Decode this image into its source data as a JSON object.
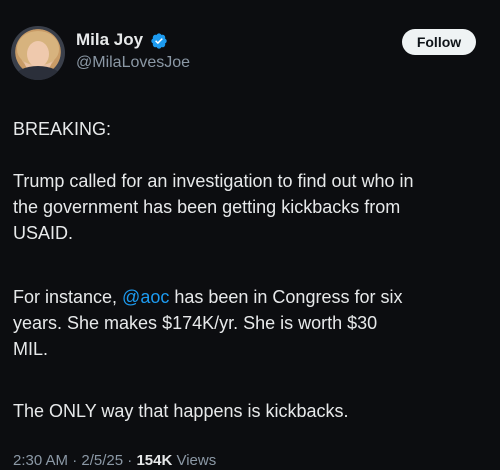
{
  "author": {
    "display_name": "Mila Joy",
    "handle": "@MilaLovesJoe",
    "verified": true,
    "icons": {
      "verified": "verified-badge-icon",
      "avatar": "profile-photo"
    }
  },
  "follow_button": {
    "label": "Follow"
  },
  "tweet": {
    "paragraph_1": "BREAKING:",
    "paragraph_2": "Trump called for an investigation to find out who in\nthe government has been getting kickbacks from\nUSAID.",
    "paragraph_3_before": "For instance, ",
    "paragraph_3_mention": "@aoc",
    "paragraph_3_after": " has been in Congress for six\nyears.  She makes $174K/yr.  She is worth $30\nMIL.",
    "paragraph_4": "The ONLY way that happens is kickbacks."
  },
  "meta": {
    "time": "2:30 AM",
    "separator_1": " · ",
    "date": "2/5/25",
    "separator_2": " · ",
    "views_count": "154K",
    "views_label": " Views"
  },
  "colors": {
    "background": "#0c0d10",
    "text": "#e7e9ea",
    "secondary": "#8b98a5",
    "accent": "#1d9bf0",
    "button_bg": "#eff3f4"
  }
}
